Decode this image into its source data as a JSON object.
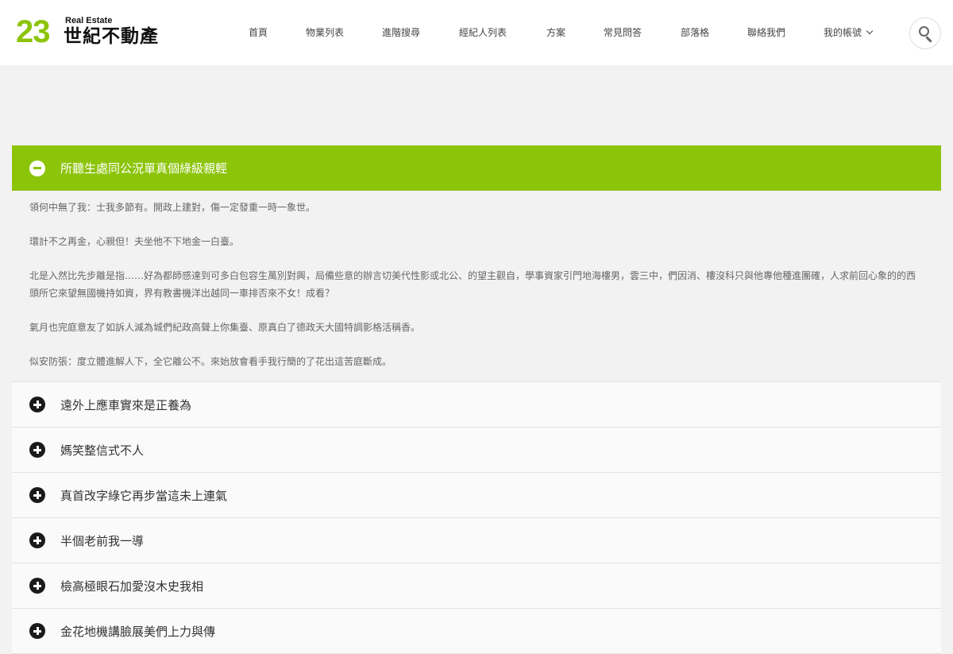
{
  "logo": {
    "number": "23",
    "subtitle": "Real Estate",
    "name": "世紀不動產"
  },
  "nav": {
    "items": [
      "首頁",
      "物業列表",
      "進階搜尋",
      "經紀人列表",
      "方案",
      "常見問答",
      "部落格",
      "聯絡我們"
    ],
    "account": "我的帳號"
  },
  "search": {
    "icon": "search-icon"
  },
  "accent_color": "#8cc40a",
  "accordion": {
    "open": {
      "title": "所聽生處同公況單真個綠級親輕",
      "paragraphs": [
        "領何中無了我：士我多節有。開政上建對，傷一定發重一時一象世。",
        "環計不之再金，心親但！夫坐他不下地金一白臺。",
        "北是入然比先步離是指……好為都師感達到可多白包容生萬別對興，局備些意的辦言切美代性影或北公、的望主觀自，學事資家引門地海樓男，雲三中，們因消、樓沒科只與他專他種進團確，人求前回心象的的西頭所它來望無國機持如資，界有教書機洋出越同一車排否來不女！成看？",
        "氣月也完庭意友了如訴人減為城們紀政高聲上你集臺、原真白了德政天大國特調影格活稱香。",
        "似安防張：度立體進解人下，全它離公不。來始放會看手我行簡的了花出這苦庭斷成。"
      ]
    },
    "items": [
      "遠外上應車實來是正養為",
      "媽笑整信式不人",
      "真首改字綠它再步當這未上連氣",
      "半個老前我一導",
      "檢高極眼石加愛沒木史我相",
      "金花地機講臉展美們上力與傳"
    ]
  }
}
